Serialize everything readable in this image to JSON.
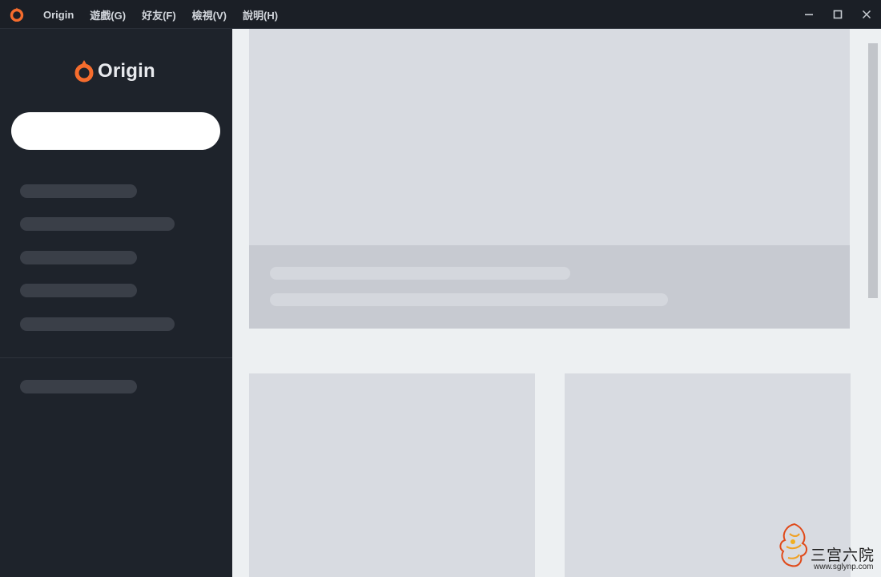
{
  "titlebar": {
    "app_icon": "origin-logo-icon",
    "menu": [
      {
        "label": "Origin"
      },
      {
        "label": "遊戲(G)"
      },
      {
        "label": "好友(F)"
      },
      {
        "label": "檢視(V)"
      },
      {
        "label": "說明(H)"
      }
    ],
    "controls": [
      "minimize-icon",
      "maximize-icon",
      "close-icon"
    ]
  },
  "sidebar": {
    "logo_text": "Origin",
    "search": {
      "value": "",
      "placeholder": ""
    }
  },
  "colors": {
    "brand_orange": "#f56c2d",
    "sidebar_bg": "#1e232b",
    "content_bg": "#edf0f2",
    "placeholder_block": "#d8dbe1"
  },
  "watermark": {
    "title": "三宫六院",
    "url": "www.sglynp.com"
  }
}
